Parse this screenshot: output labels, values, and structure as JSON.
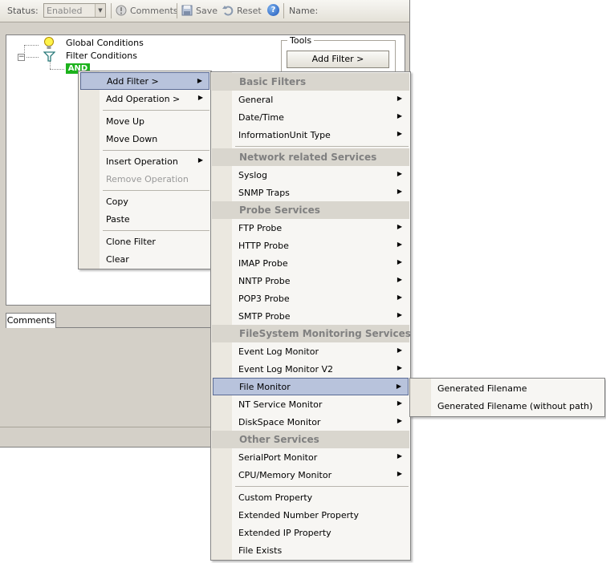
{
  "toolbar": {
    "status_label": "Status:",
    "status_value": "Enabled",
    "comments_label": "Comments",
    "save_label": "Save",
    "reset_label": "Reset",
    "help_glyph": "?",
    "name_label": "Name:"
  },
  "tree": {
    "global_conditions": "Global Conditions",
    "filter_conditions": "Filter Conditions",
    "and_node": "AND"
  },
  "tools": {
    "legend": "Tools",
    "add_filter_button": "Add Filter >"
  },
  "comments": {
    "tab_label": "Comments"
  },
  "context_menu": {
    "items": [
      {
        "label": "Add Filter >",
        "submenu": true,
        "selected": true
      },
      {
        "label": "Add Operation >",
        "submenu": true
      },
      {
        "label": "Move Up"
      },
      {
        "label": "Move Down"
      },
      {
        "label": "Insert Operation",
        "submenu": true
      },
      {
        "label": "Remove Operation",
        "disabled": true
      },
      {
        "label": "Copy"
      },
      {
        "label": "Paste"
      },
      {
        "label": "Clone Filter"
      },
      {
        "label": "Clear"
      }
    ]
  },
  "filter_menu": {
    "headers": {
      "basic": "Basic Filters",
      "network": "Network related Services",
      "probe": "Probe Services",
      "filesystem": "FileSystem Monitoring Services",
      "other": "Other Services"
    },
    "items": {
      "general": "General",
      "datetime": "Date/Time",
      "infounit": "InformationUnit Type",
      "syslog": "Syslog",
      "snmp": "SNMP Traps",
      "ftp": "FTP Probe",
      "http": "HTTP Probe",
      "imap": "IMAP Probe",
      "nntp": "NNTP Probe",
      "pop3": "POP3 Probe",
      "smtp": "SMTP Probe",
      "eventlog": "Event Log Monitor",
      "eventlog2": "Event Log Monitor V2",
      "filemon": "File Monitor",
      "ntservice": "NT Service Monitor",
      "diskspace": "DiskSpace Monitor",
      "serialport": "SerialPort Monitor",
      "cpumem": "CPU/Memory Monitor",
      "customprop": "Custom Property",
      "extnumber": "Extended Number Property",
      "extip": "Extended IP Property",
      "fileexists": "File Exists"
    }
  },
  "file_monitor_menu": {
    "items": [
      "Generated Filename",
      "Generated Filename (without path)"
    ]
  },
  "submenu_arrow": "▶",
  "dropdown_arrow": "▼"
}
